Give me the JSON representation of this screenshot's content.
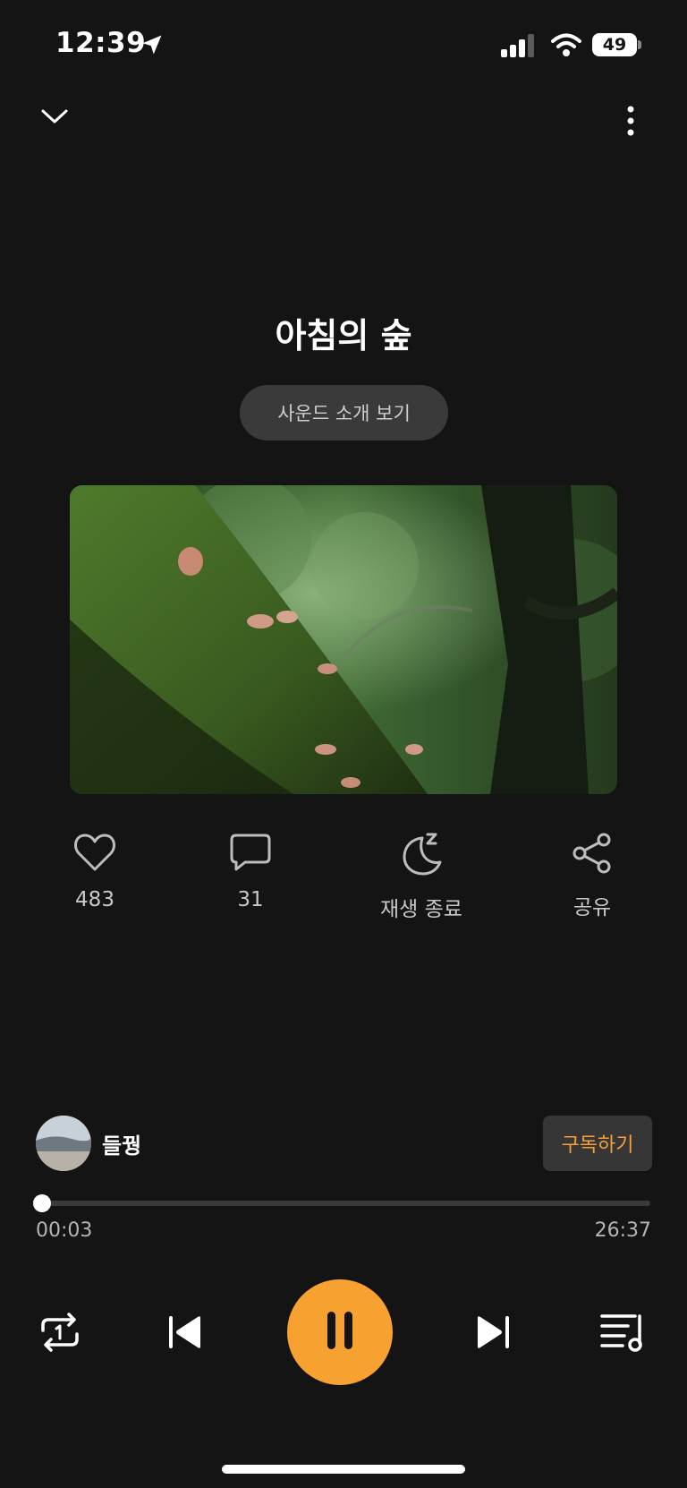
{
  "status_bar": {
    "time": "12:39",
    "battery": "49",
    "icons": [
      "location-arrow-icon",
      "signal-icon",
      "wifi-icon",
      "battery-icon"
    ]
  },
  "header": {
    "collapse_icon": "chevron-down-icon",
    "more_icon": "more-vertical-icon"
  },
  "track": {
    "title": "아침의 숲",
    "intro_button": "사운드 소개 보기",
    "artwork": "forest-moss-mushrooms-image"
  },
  "actions": {
    "like_count": "483",
    "comment_count": "31",
    "sleep_timer_label": "재생 종료",
    "share_label": "공유"
  },
  "creator": {
    "name": "들꿩",
    "subscribe_label": "구독하기"
  },
  "playback": {
    "current_time": "00:03",
    "total_time": "26:37",
    "progress_fraction": 0.0019
  },
  "controls": {
    "repeat_icon": "repeat-one-icon",
    "prev_icon": "skip-previous-icon",
    "pause_icon": "pause-icon",
    "next_icon": "skip-next-icon",
    "playlist_icon": "playlist-music-icon"
  },
  "colors": {
    "background": "#141414",
    "accent": "#f7a131",
    "subscribe_text": "#f5a03a"
  }
}
